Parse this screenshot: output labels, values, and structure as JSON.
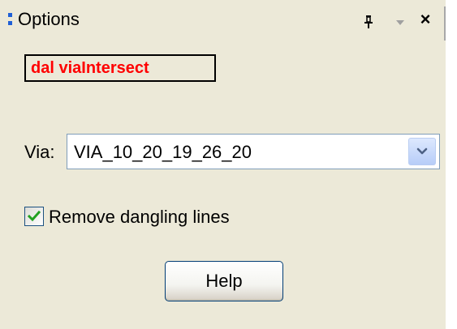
{
  "panel": {
    "title": "Options",
    "command_label": "dal viaIntersect",
    "command_color": "#ff0000",
    "icons": {
      "pin": "pin-icon",
      "dropdown": "chevron-down-icon",
      "close": "close-icon",
      "close_glyph": "×"
    }
  },
  "via": {
    "label": "Via:",
    "selected": "VIA_10_20_19_26_20"
  },
  "remove_dangling": {
    "label": "Remove dangling lines",
    "checked": true,
    "check_color": "#21a121"
  },
  "help_button": {
    "label": "Help"
  },
  "colors": {
    "panel_bg": "#ece9d8",
    "accent_blue": "#1f5fd6"
  }
}
